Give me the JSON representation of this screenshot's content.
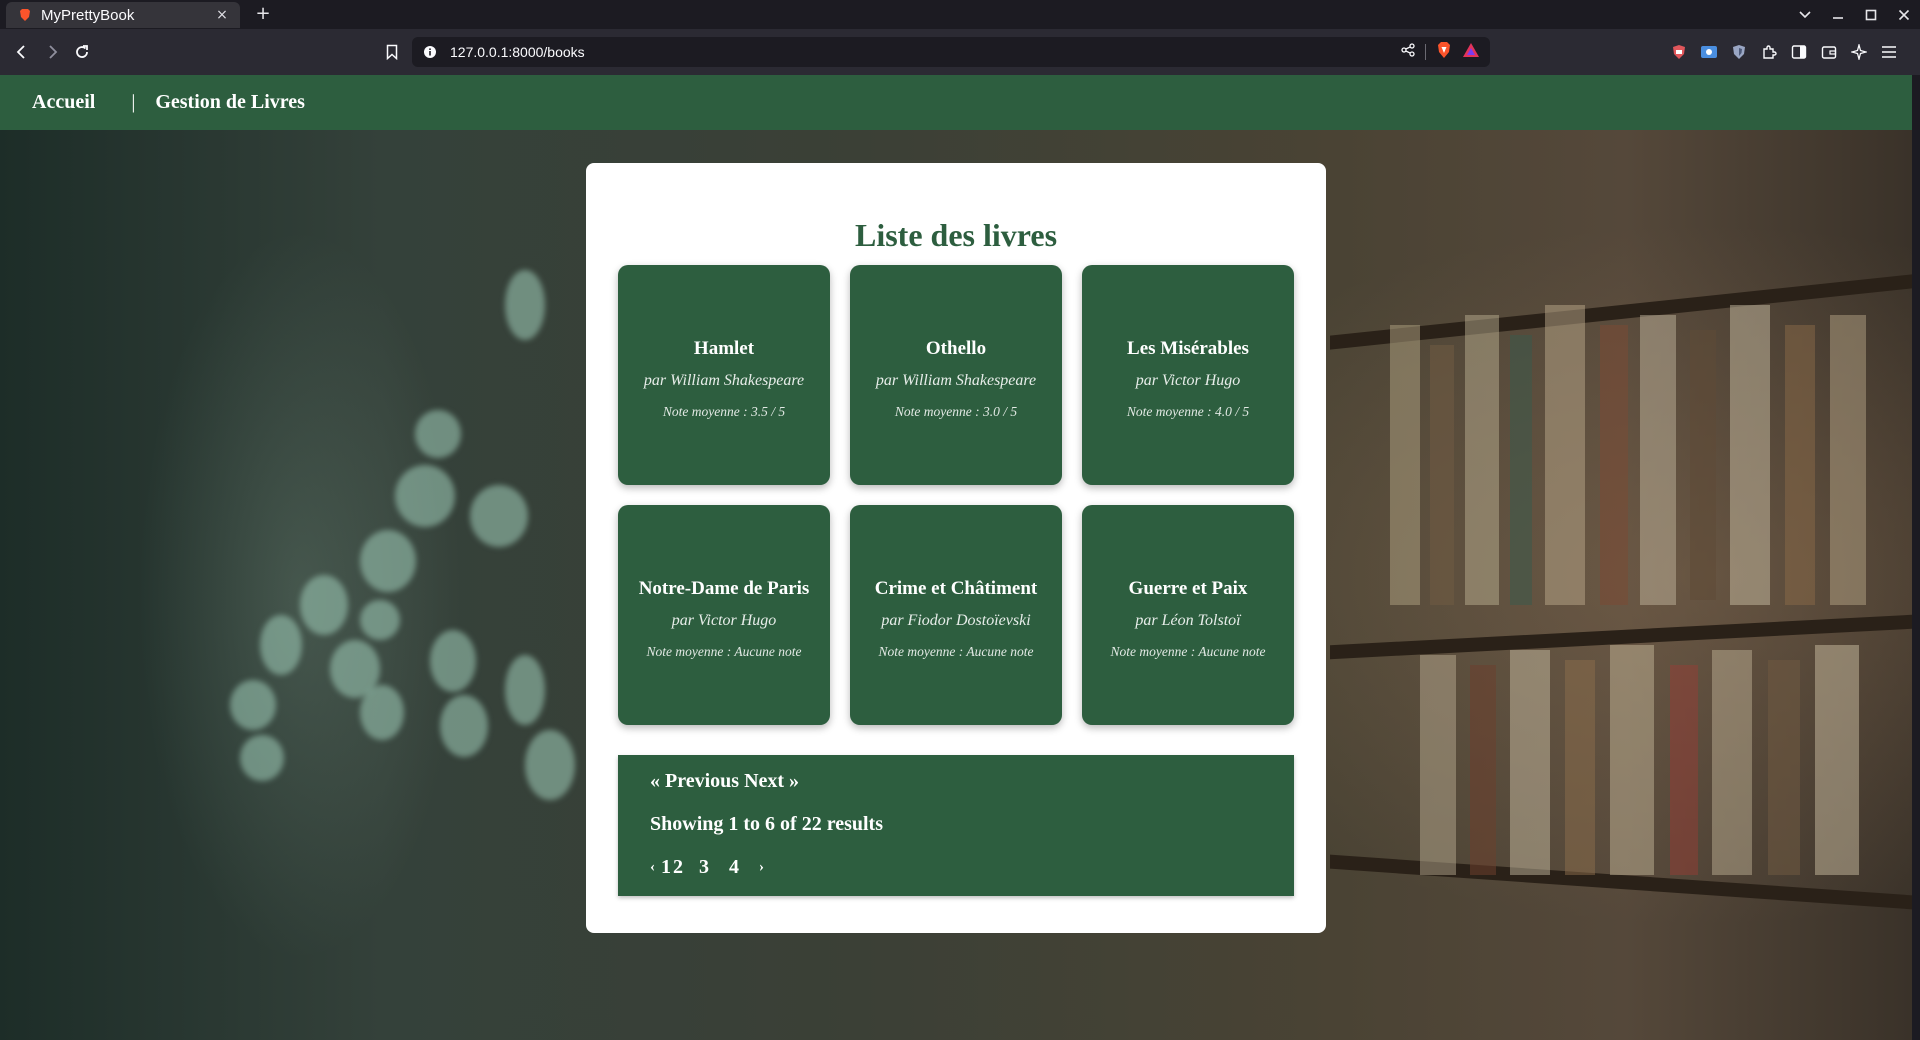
{
  "browser": {
    "tab_title": "MyPrettyBook",
    "tab_close": "×",
    "new_tab": "+",
    "url": "127.0.0.1:8000/books"
  },
  "site": {
    "nav": {
      "home": "Accueil",
      "separator": "|",
      "books": "Gestion de Livres"
    },
    "page_title": "Liste des livres",
    "books": [
      {
        "title": "Hamlet",
        "author": "par William Shakespeare",
        "rating": "Note moyenne : 3.5 / 5"
      },
      {
        "title": "Othello",
        "author": "par William Shakespeare",
        "rating": "Note moyenne : 3.0 / 5"
      },
      {
        "title": "Les Misérables",
        "author": "par Victor Hugo",
        "rating": "Note moyenne : 4.0 / 5"
      },
      {
        "title": "Notre-Dame de Paris",
        "author": "par Victor Hugo",
        "rating": "Note moyenne : Aucune note"
      },
      {
        "title": "Crime et Châtiment",
        "author": "par Fiodor Dostoïevski",
        "rating": "Note moyenne : Aucune note"
      },
      {
        "title": "Guerre et Paix",
        "author": "par Léon Tolstoï",
        "rating": "Note moyenne : Aucune note"
      }
    ],
    "pagination": {
      "previous": "« Previous",
      "next": "Next »",
      "summary": "Showing 1 to 6 of 22 results",
      "prev_arrow": "‹",
      "next_arrow": "›",
      "pages": [
        "1",
        "2",
        "3",
        "4"
      ]
    }
  },
  "colors": {
    "brand_green": "#2d5e3f",
    "panel_white": "#ffffff"
  },
  "icons": [
    "brave-lion-icon",
    "back-icon",
    "forward-icon",
    "reload-icon",
    "bookmark-icon",
    "info-icon",
    "share-icon",
    "brave-shields-icon",
    "brave-rewards-icon",
    "extension-icon",
    "sidebar-icon",
    "wallet-icon",
    "leo-ai-icon",
    "menu-icon"
  ]
}
